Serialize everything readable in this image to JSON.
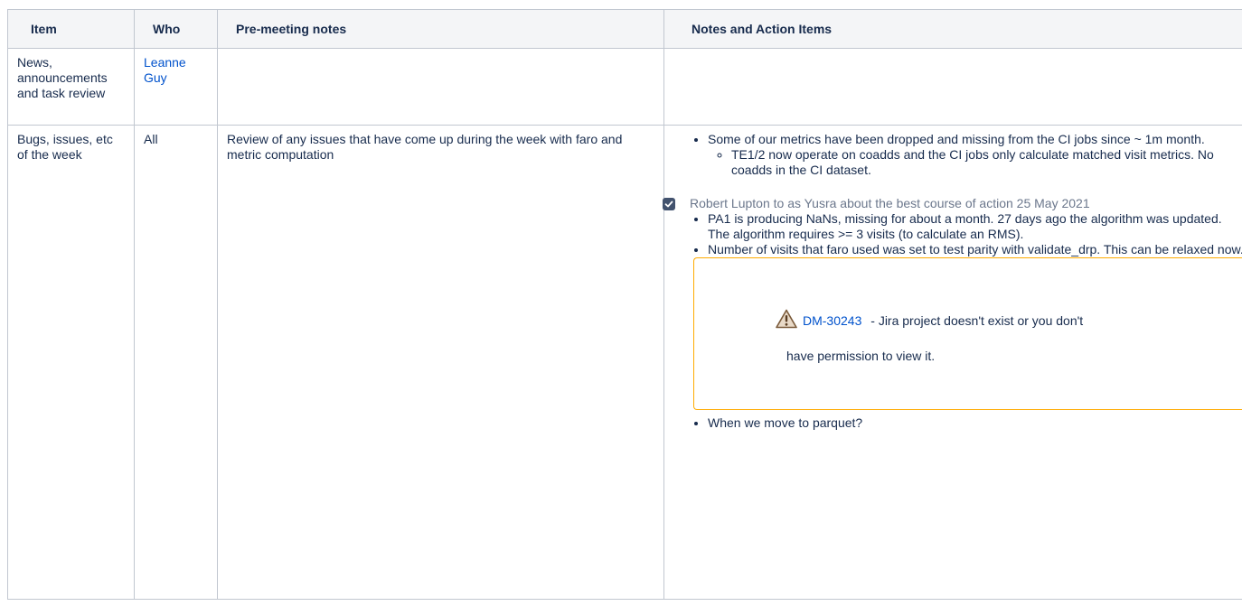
{
  "headers": {
    "item": "Item",
    "who": "Who",
    "pre": "Pre-meeting notes",
    "notes": "Notes and  Action Items"
  },
  "row1": {
    "item": "News, announcements and task review",
    "who": "Leanne Guy",
    "pre": "",
    "notes": ""
  },
  "row2": {
    "item": "Bugs, issues, etc of the week",
    "who": "All",
    "pre": "Review of any issues that have come up during the week with faro and metric computation",
    "bullet1": "Some of our metrics have been dropped and missing from the CI jobs since ~ 1m month.",
    "sub1": "TE1/2 now operate on coadds and the CI jobs only calculate matched visit metrics. No coadds in the CI dataset.",
    "task": {
      "checked": true,
      "assignee": "Robert Lupton",
      "text": " to as Yusra about the best course of action ",
      "date": "25 May 2021"
    },
    "bullet2": "PA1 is producing NaNs, missing for about a month. 27 days ago the algorithm was updated. The algorithm requires >= 3 visits (to calculate an RMS).",
    "bullet3": "Number of visits that faro used was set to test parity with validate_drp. This can be relaxed now.",
    "jira": {
      "key": "DM-30243",
      "message": " - Jira project doesn't exist or you don't",
      "message2": "have permission to view it.",
      "icon": "warning-icon"
    },
    "bullet4": "When we move to parquet?"
  },
  "colors": {
    "link": "#0052cc",
    "border": "#c1c7d0",
    "header_bg": "#f4f5f7",
    "warning_border": "#ffab00"
  }
}
